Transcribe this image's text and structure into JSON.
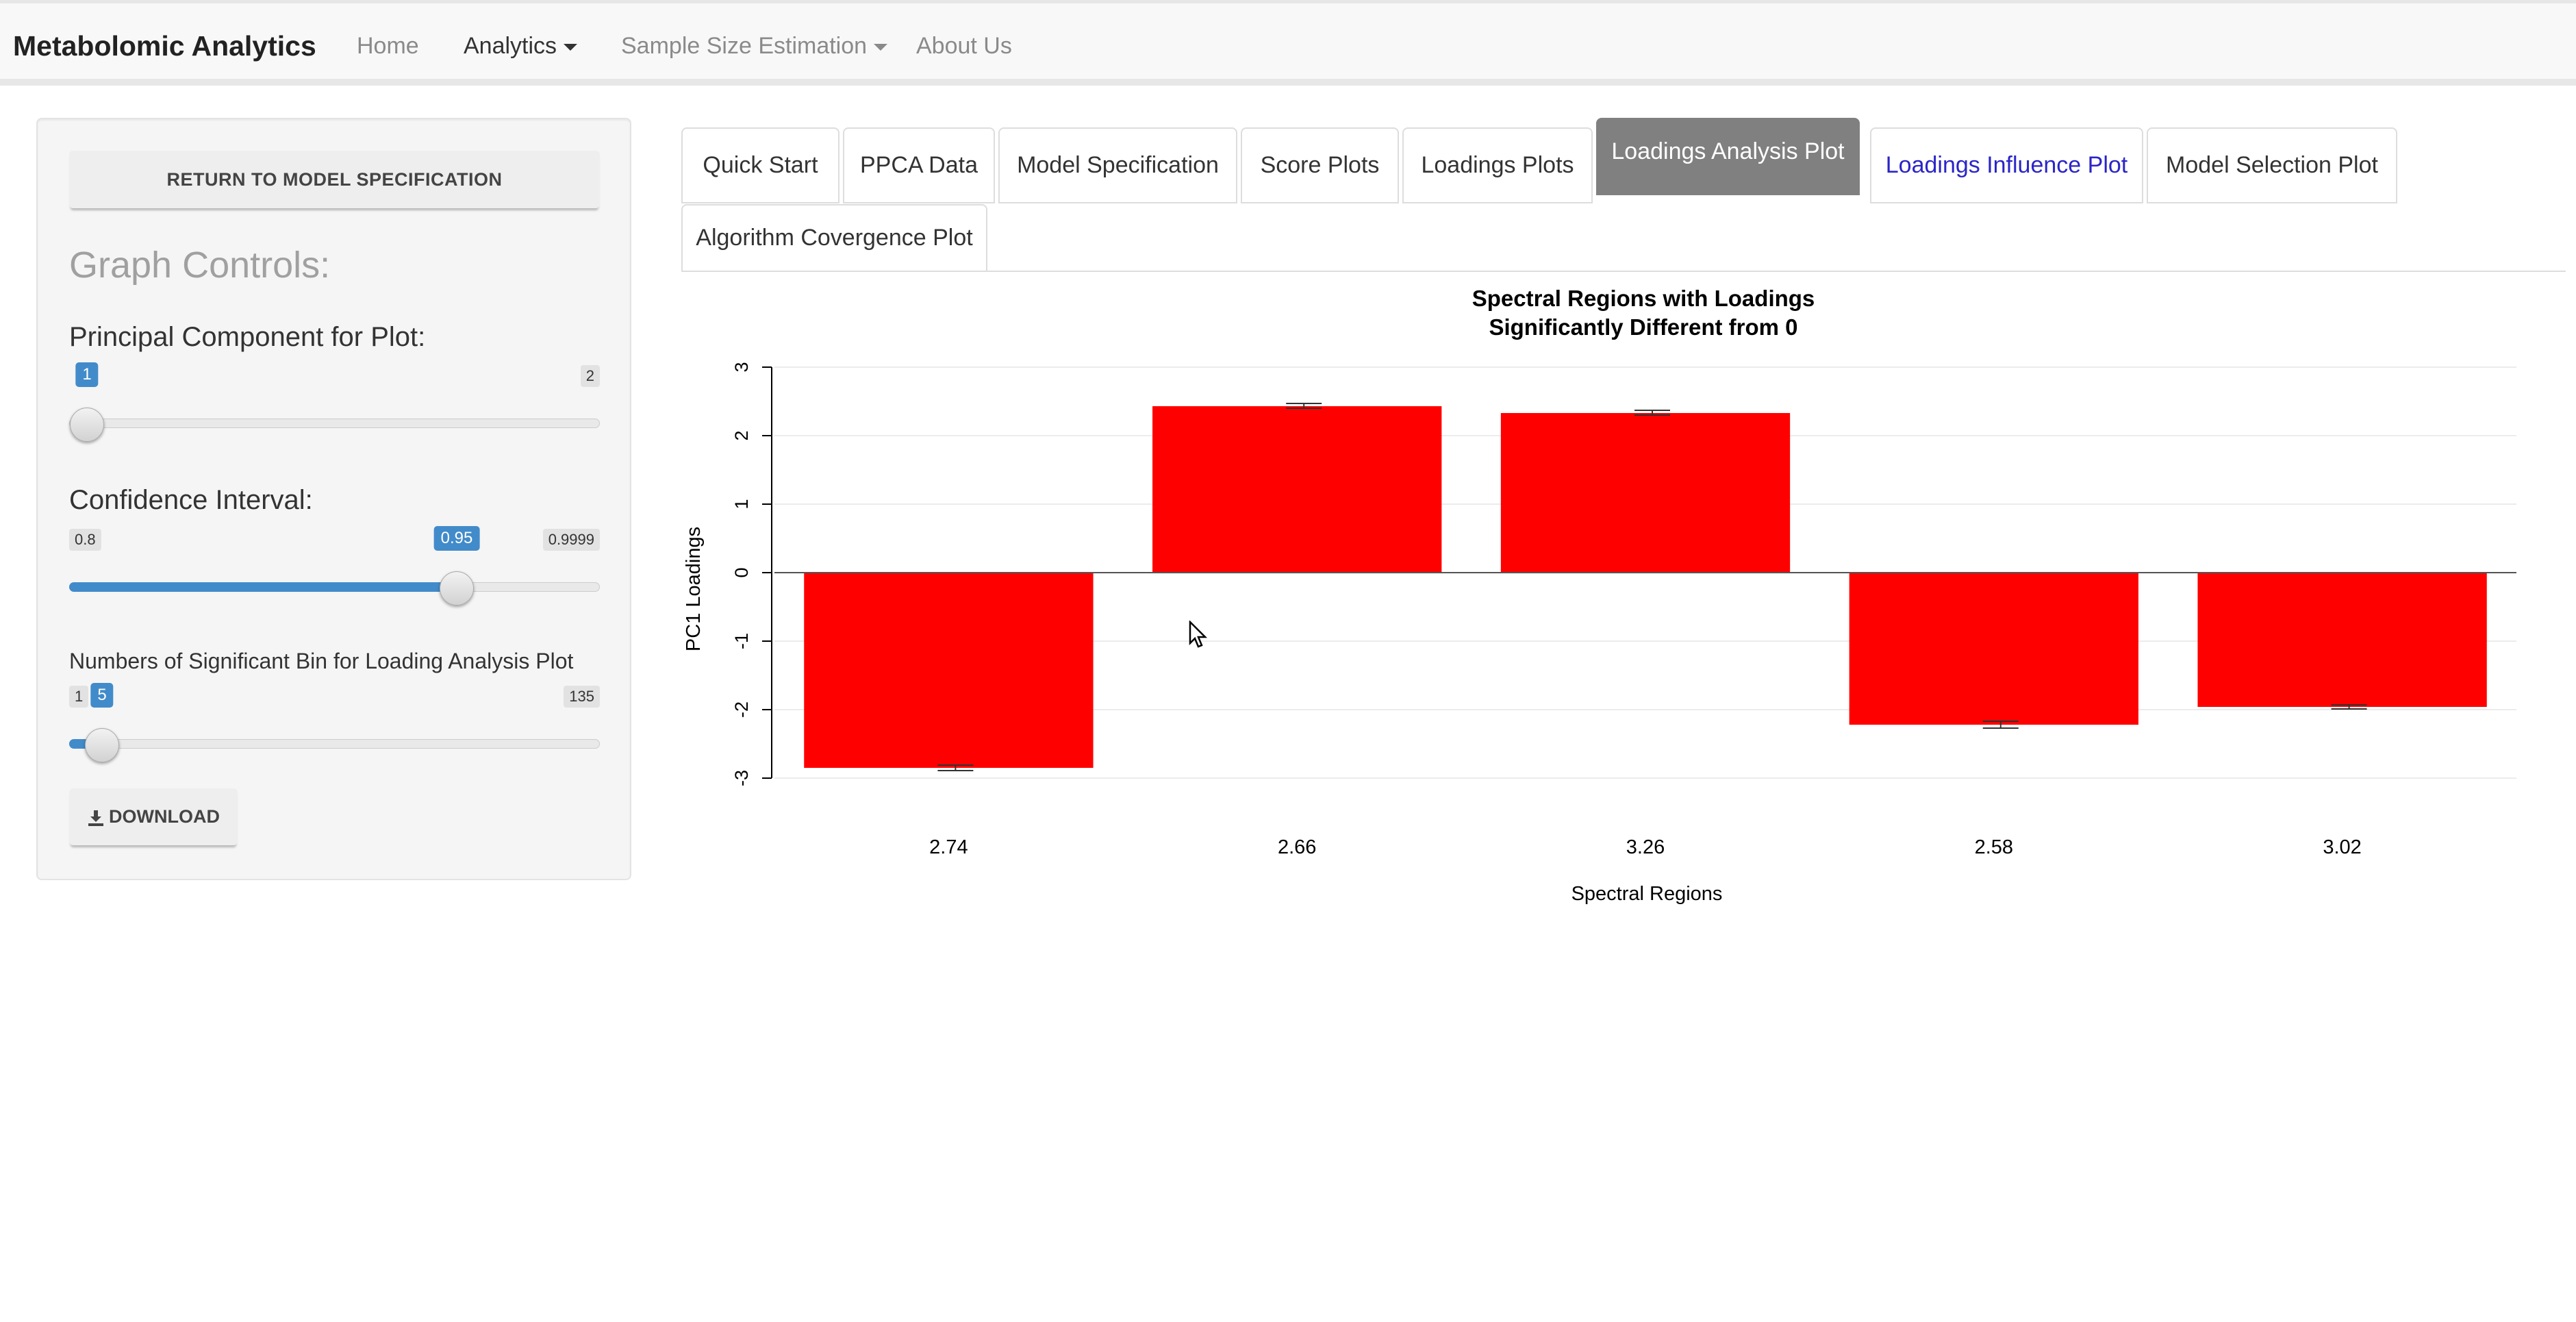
{
  "navbar": {
    "brand": "Metabolomic Analytics",
    "items": [
      {
        "label": "Home",
        "dropdown": false,
        "active": false
      },
      {
        "label": "Analytics",
        "dropdown": true,
        "active": true
      },
      {
        "label": "Sample Size Estimation",
        "dropdown": true,
        "active": false
      },
      {
        "label": "About Us",
        "dropdown": false,
        "active": false
      }
    ]
  },
  "sidebar": {
    "return_button": "RETURN TO MODEL SPECIFICATION",
    "heading": "Graph Controls:",
    "pc_slider": {
      "label": "Principal Component for Plot:",
      "min": "1",
      "max": "2",
      "value": "1",
      "value_num": 1,
      "min_num": 1,
      "max_num": 2
    },
    "ci_slider": {
      "label": "Confidence Interval:",
      "min": "0.8",
      "max": "0.9999",
      "value": "0.95",
      "value_num": 0.95,
      "min_num": 0.8,
      "max_num": 0.9999
    },
    "bins_slider": {
      "label": "Numbers of Significant Bin for Loading Analysis Plot",
      "min": "1",
      "max": "135",
      "value": "5",
      "value_num": 5,
      "min_num": 1,
      "max_num": 135
    },
    "download_button": "DOWNLOAD"
  },
  "tabs": [
    {
      "label": "Quick Start",
      "state": "normal"
    },
    {
      "label": "PPCA Data",
      "state": "normal"
    },
    {
      "label": "Model Specification",
      "state": "normal"
    },
    {
      "label": "Score Plots",
      "state": "normal"
    },
    {
      "label": "Loadings Plots",
      "state": "normal"
    },
    {
      "label": "Loadings Analysis Plot",
      "state": "active"
    },
    {
      "label": "Loadings Influence Plot",
      "state": "link"
    },
    {
      "label": "Model Selection Plot",
      "state": "normal"
    },
    {
      "label": "Algorithm Covergence Plot",
      "state": "normal"
    }
  ],
  "colors": {
    "accent": "#428bca",
    "bar": "#ff0000",
    "tab_active": "#808080",
    "tab_link": "#2a25c8"
  },
  "chart_data": {
    "type": "bar",
    "title": "Spectral Regions with Loadings",
    "subtitle": "Significantly Different from 0",
    "xlabel": "Spectral Regions",
    "ylabel": "PC1 Loadings",
    "categories": [
      "2.74",
      "2.66",
      "3.26",
      "2.58",
      "3.02"
    ],
    "values": [
      -2.85,
      2.43,
      2.33,
      -2.22,
      -1.96
    ],
    "error_low": [
      -2.89,
      2.4,
      2.3,
      -2.27,
      -1.99
    ],
    "error_high": [
      -2.81,
      2.47,
      2.37,
      -2.17,
      -1.93
    ],
    "ylim": [
      -3,
      3
    ],
    "yticks": [
      "-3",
      "-2",
      "-1",
      "0",
      "1",
      "2",
      "3"
    ],
    "grid": true,
    "legend": "none"
  }
}
